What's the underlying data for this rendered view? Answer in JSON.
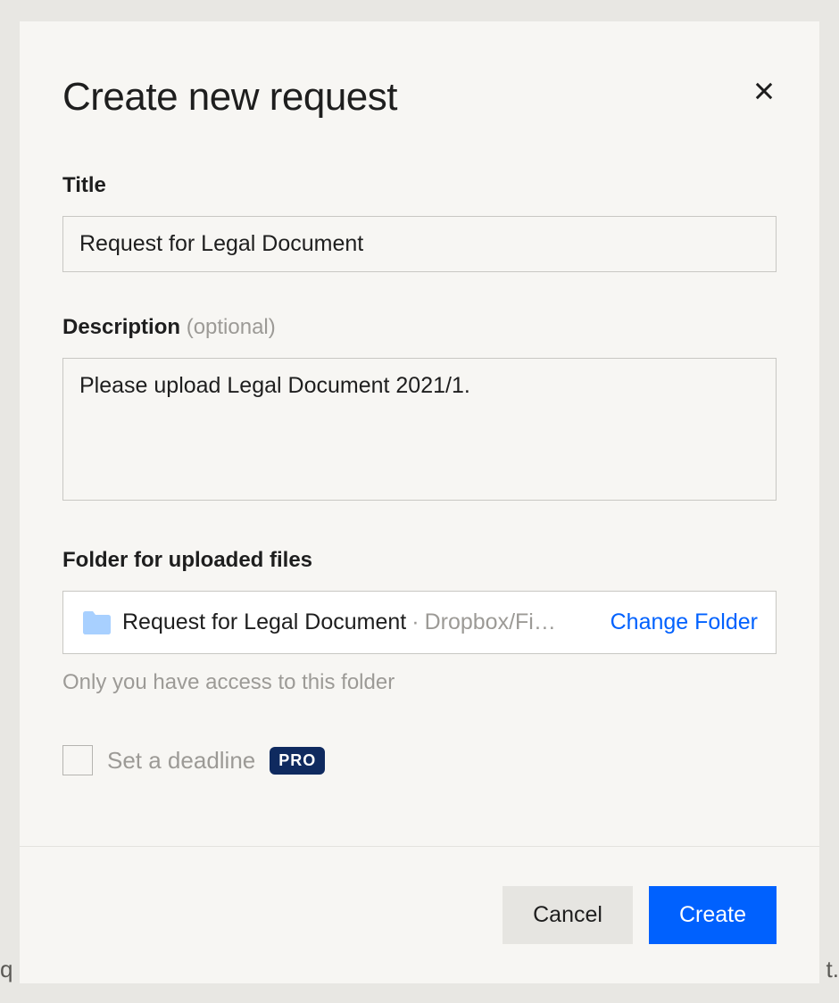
{
  "background": {
    "left_fragment": "q",
    "right_fragment": "t."
  },
  "modal": {
    "title": "Create new request",
    "fields": {
      "title": {
        "label": "Title",
        "value": "Request for Legal Document"
      },
      "description": {
        "label": "Description ",
        "optional": "(optional)",
        "value": "Please upload Legal Document 2021/1."
      },
      "folder": {
        "label": "Folder for uploaded files",
        "name": "Request for Legal Document",
        "separator": " · ",
        "location": "Dropbox/Fi…",
        "change_label": "Change Folder",
        "hint": "Only you have access to this folder"
      },
      "deadline": {
        "label": "Set a deadline",
        "badge": "PRO"
      }
    },
    "footer": {
      "cancel": "Cancel",
      "create": "Create"
    }
  }
}
